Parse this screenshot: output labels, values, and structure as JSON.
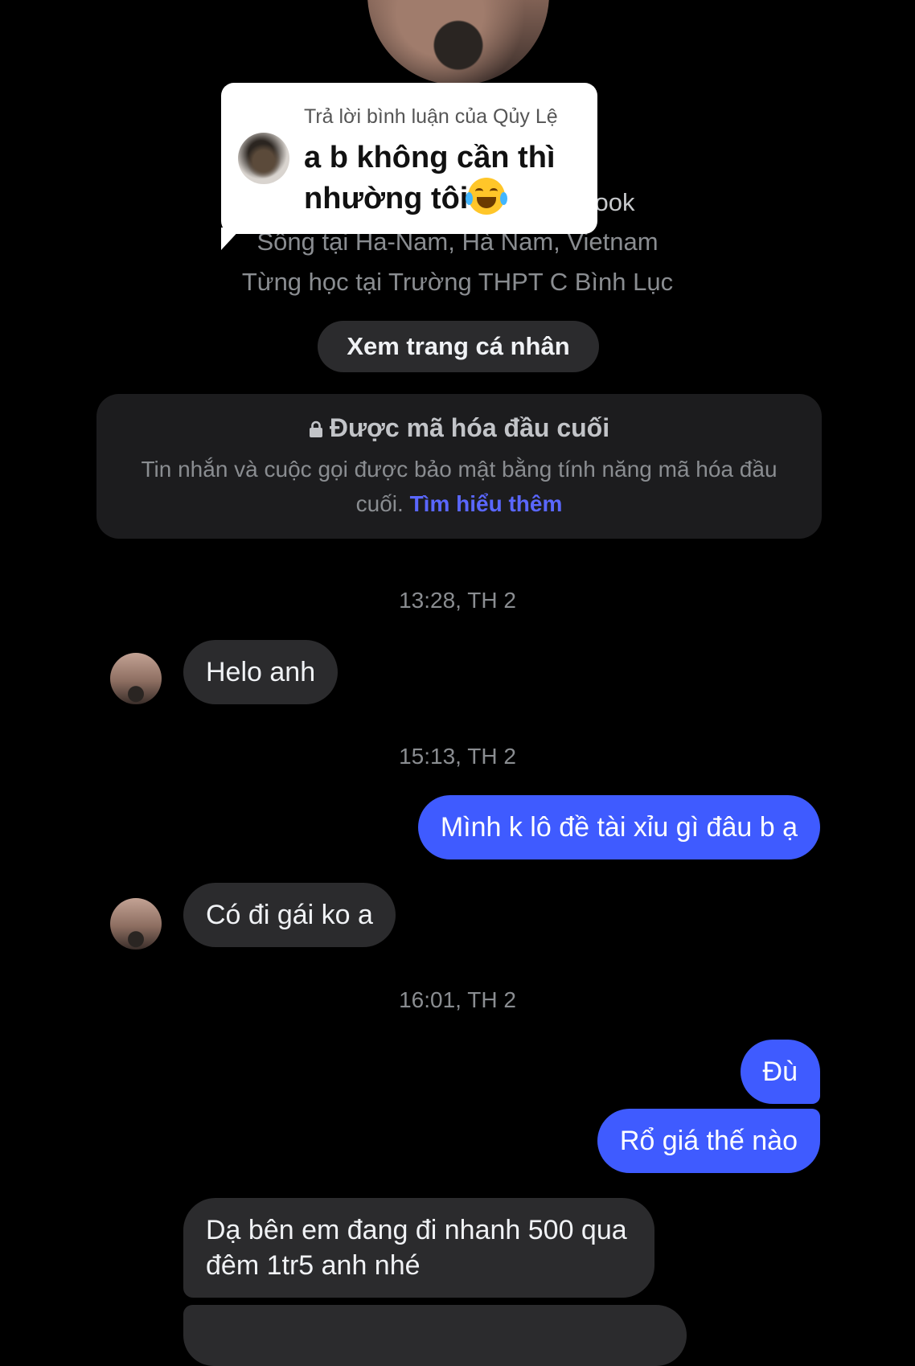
{
  "profile": {
    "facebook_fragment": "ebook",
    "lives_in": "Sống tại Ha-Nam, Hà Nam, Vietnam",
    "studied_at": "Từng học tại Trường THPT C Bình Lục",
    "view_profile_label": "Xem trang cá nhân"
  },
  "encryption": {
    "title": "Được mã hóa đầu cuối",
    "body": "Tin nhắn và cuộc gọi được bảo mật bằng tính năng mã hóa đầu cuối.",
    "learn_more": "Tìm hiểu thêm"
  },
  "reply_overlay": {
    "caption": "Trả lời bình luận của Qủy Lệ",
    "text": "a b không cần thì nhường tôi",
    "emoji": "face-with-tears-of-joy"
  },
  "messages": {
    "ts1": "13:28, TH 2",
    "m1": "Helo anh",
    "ts2": "15:13, TH 2",
    "m2": "Mình k lô đề tài xỉu gì đâu b ạ",
    "m3": "Có đi gái ko a",
    "ts3": "16:01, TH 2",
    "m4": "Đù",
    "m5": "Rổ giá thế nào",
    "m6_line1": "Dạ bên em đang đi nhanh 500 qua",
    "m6_line2": "đêm 1tr5 anh nhé"
  },
  "colors": {
    "background": "#000000",
    "incoming_bubble": "#2b2b2d",
    "outgoing_bubble": "#3f5bff",
    "link": "#5a67ff"
  }
}
